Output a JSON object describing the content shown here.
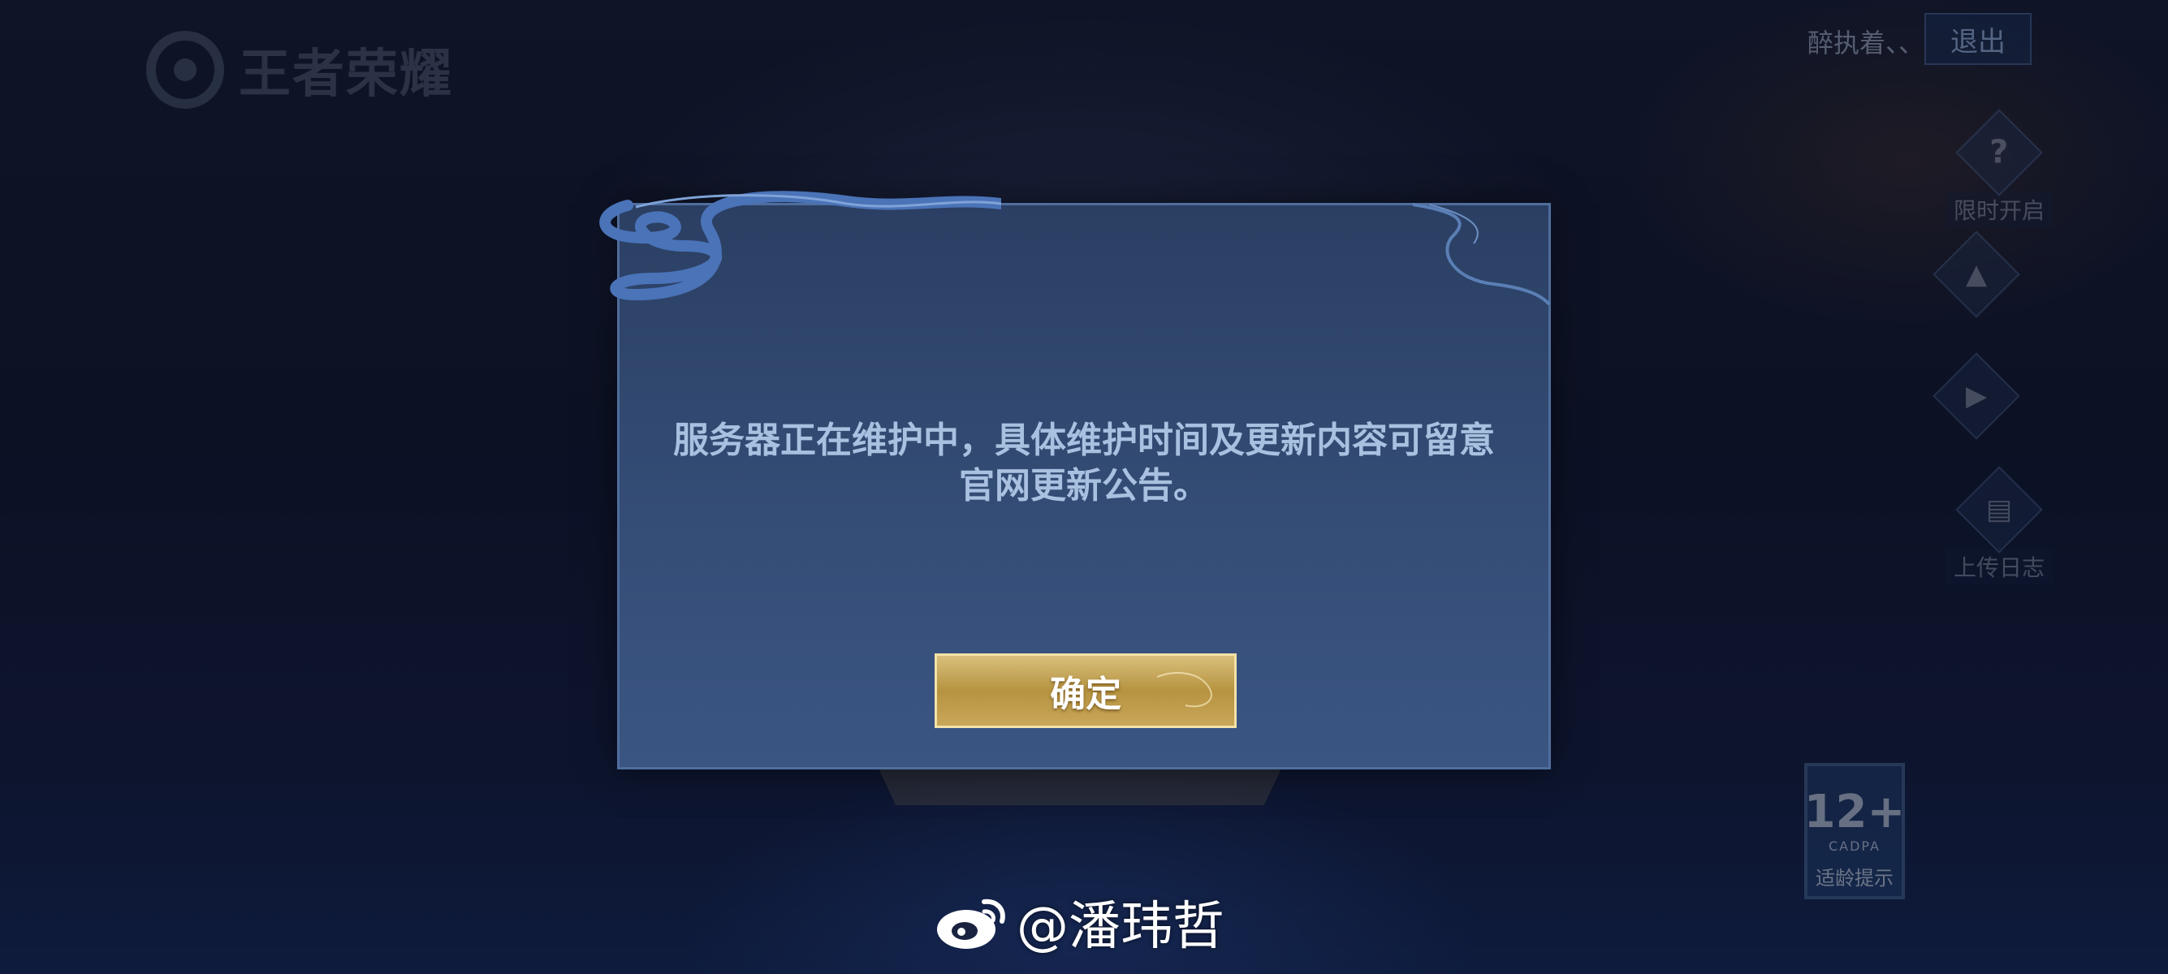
{
  "game": {
    "logo_text": "王者荣耀"
  },
  "header": {
    "user_name": "醉执着、、",
    "logout_label": "退出"
  },
  "side_buttons": [
    {
      "icon": "question-icon",
      "glyph": "?",
      "label": "限时开启"
    },
    {
      "icon": "gamepad-icon",
      "glyph": "🎮",
      "label": ""
    },
    {
      "icon": "speaker-icon",
      "glyph": "🔊",
      "label": ""
    },
    {
      "icon": "clipboard-icon",
      "glyph": "📋",
      "label": "上传日志"
    }
  ],
  "age_rating": {
    "age": "12+",
    "org": "CADPA",
    "tip": "适龄提示"
  },
  "modal": {
    "message_line1": "服务器正在维护中，具体维护时间及更新内容可留意",
    "message_line2": "官网更新公告。",
    "confirm_label": "确定"
  },
  "watermark": {
    "text": "@潘玮哲"
  },
  "colors": {
    "modal_bg": "#344d76",
    "modal_text": "#a9c0e0",
    "confirm_gold": "#c9a75a"
  }
}
